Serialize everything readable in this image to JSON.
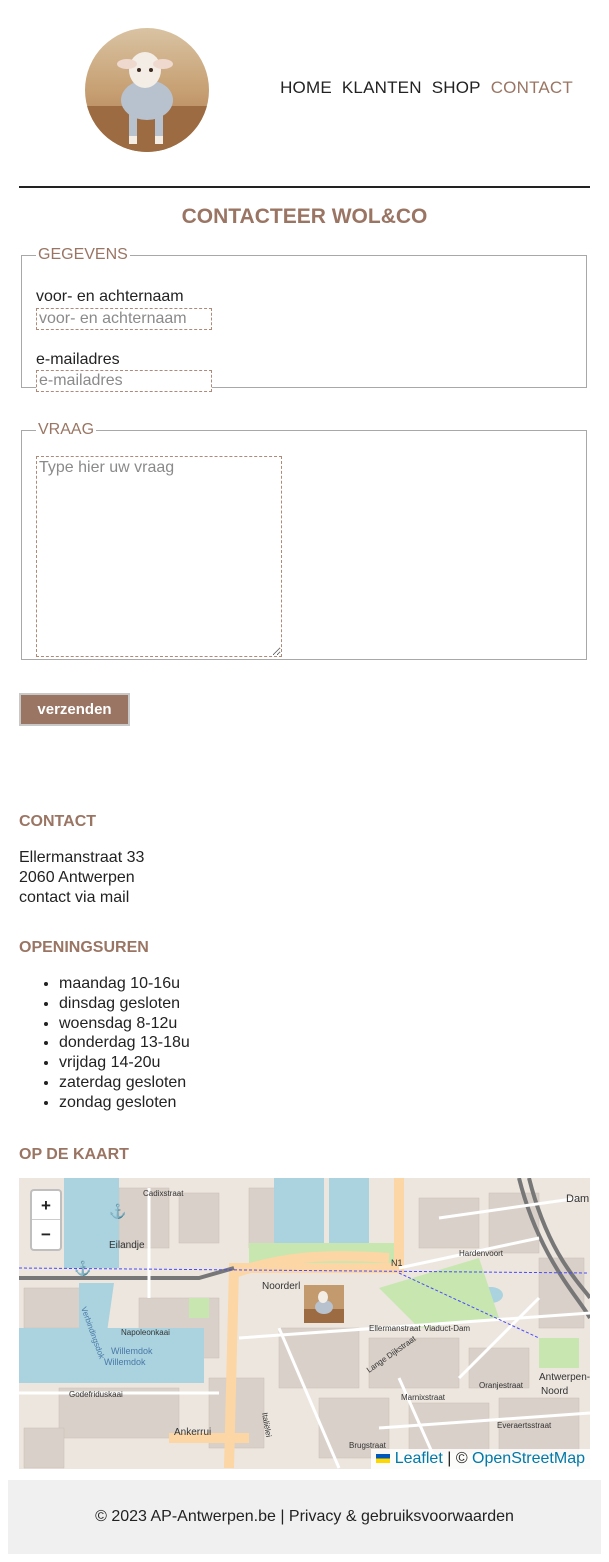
{
  "nav": {
    "items": [
      {
        "label": "HOME"
      },
      {
        "label": "KLANTEN"
      },
      {
        "label": "SHOP"
      },
      {
        "label": "CONTACT"
      }
    ]
  },
  "page": {
    "title": "CONTACTEER WOL&CO"
  },
  "form": {
    "gegevens_legend": "GEGEVENS",
    "name_label": "voor- en achternaam",
    "name_placeholder": "voor- en achternaam",
    "email_label": "e-mailadres",
    "email_placeholder": "e-mailadres",
    "vraag_legend": "VRAAG",
    "question_placeholder": "Type hier uw vraag",
    "submit_label": "verzenden"
  },
  "contact": {
    "title": "CONTACT",
    "street": "Ellermanstraat 33",
    "city": "2060 Antwerpen",
    "mail_text": "contact via mail"
  },
  "hours": {
    "title": "OPENINGSUREN",
    "items": [
      "maandag 10-16u",
      "dinsdag gesloten",
      "woensdag 8-12u",
      "donderdag 13-18u",
      "vrijdag 14-20u",
      "zaterdag gesloten",
      "zondag gesloten"
    ]
  },
  "map": {
    "title": "OP DE KAART",
    "zoom_in": "+",
    "zoom_out": "−",
    "attribution_leaflet": "Leaflet",
    "attribution_sep": " | © ",
    "attribution_osm": "OpenStreetMap",
    "labels": [
      "Cadixstraat",
      "Eilandje",
      "Noorderlaan",
      "N1",
      "Hardenvoort",
      "Viaduct-Dam",
      "Dam",
      "Napoleonkaai",
      "Willemdok",
      "Willemdok",
      "Godefriduskaai",
      "Ankerrui",
      "Italiëlei",
      "Ellermanstraat",
      "Viaduct-Dam",
      "Oranjestraat",
      "Antwerpen-Noord",
      "Everaertsstraat",
      "Brugstraat",
      "Marnixstraat",
      "Lange Dijkstraat",
      "Noorderl",
      "Verbindingsdok"
    ],
    "colors": {
      "water": "#aad3df",
      "park": "#c8e6b0",
      "road_major": "#fcd6a4",
      "block": "#d9d0c9"
    }
  },
  "footer": {
    "text": "© 2023 AP-Antwerpen.be | Privacy & gebruiksvoorwaarden"
  },
  "colors": {
    "accent": "#9a7563",
    "text": "#222222",
    "footer_bg": "#f0f0f0"
  }
}
